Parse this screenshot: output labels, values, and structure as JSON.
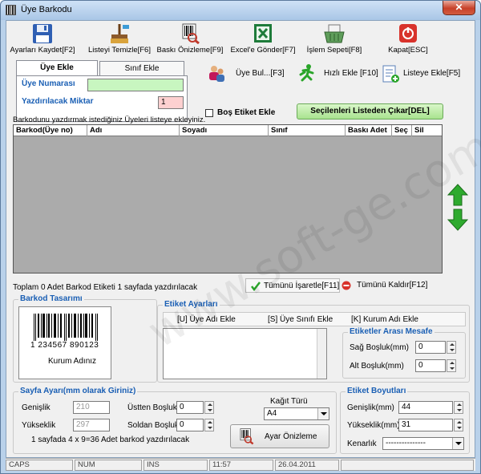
{
  "window": {
    "title": "Üye Barkodu",
    "close_glyph": "✕"
  },
  "toolbar": {
    "save": "Ayarları Kaydet[F2]",
    "clear": "Listeyi Temizle[F6]",
    "preview": "Baskı Önizleme[F9]",
    "excel": "Excel'e Gönder[F7]",
    "queue": "İşlem Sepeti[F8]",
    "close": "Kapat[ESC]"
  },
  "tabs": {
    "member": "Üye Ekle",
    "class": "Sınıf Ekle"
  },
  "member_panel": {
    "number_label": "Üye Numarası",
    "number_value": "",
    "count_label": "Yazdırılacak Miktar",
    "count_value": "1"
  },
  "actions": {
    "find": "Üye Bul...[F3]",
    "quick_add": "Hızlı Ekle [F10]",
    "add_list": "Listeye Ekle[F5]",
    "empty_label": "Boş Etiket Ekle",
    "remove_selected": "Seçilenleri Listeden Çıkar[DEL]"
  },
  "hint": "Barkodunu yazdırmak istediğiniz Üyeleri listeye ekleyiniz.",
  "grid": {
    "columns": [
      "Barkod(Üye no)",
      "Adı",
      "Soyadı",
      "Sınıf",
      "Baskı Adet",
      "Seç",
      "Sil"
    ]
  },
  "summary": {
    "text": "Toplam 0 Adet Barkod Etiketi 1 sayfada yazdırılacak",
    "mark_all": "Tümünü İşaretle[F11]",
    "unmark_all": "Tümünü Kaldır[F12]"
  },
  "barcode_design": {
    "title": "Barkod Tasarımı",
    "digits": "1 234567 890123",
    "org": "Kurum Adınız"
  },
  "label_settings": {
    "title": "Etiket Ayarları",
    "add_name": "[U] Üye Adı Ekle",
    "add_class": "[S] Üye Sınıfı Ekle",
    "add_org": "[K] Kurum Adı Ekle",
    "text_value": "",
    "spacing_title": "Etiketler Arası Mesafe",
    "right_label": "Sağ Boşluk(mm)",
    "right_value": "0",
    "bottom_label": "Alt Boşluk(mm)",
    "bottom_value": "0"
  },
  "page_settings": {
    "title": "Sayfa Ayarı(mm olarak Giriniz)",
    "width_label": "Genişlik",
    "width_value": "210",
    "height_label": "Yükseklik",
    "height_value": "297",
    "top_label": "Üstten Boşluk",
    "top_value": "0",
    "left_label": "Soldan Boşluk",
    "left_value": "0",
    "info": "1 sayfada 4 x 9=36 Adet barkod yazdırılacak",
    "paper_label": "Kağıt Türü",
    "paper_value": "A4",
    "preview_btn": "Ayar Önizleme"
  },
  "label_size": {
    "title": "Etiket Boyutları",
    "width_label": "Genişlik(mm)",
    "width_value": "44",
    "height_label": "Yükseklik(mm)",
    "height_value": "31",
    "border_label": "Kenarlık",
    "border_value": "---------------"
  },
  "statusbar": {
    "caps": "CAPS",
    "num": "NUM",
    "ins": "INS",
    "time": "11:57",
    "date": "26.04.2011"
  },
  "watermark": "www.soft-ge.com"
}
